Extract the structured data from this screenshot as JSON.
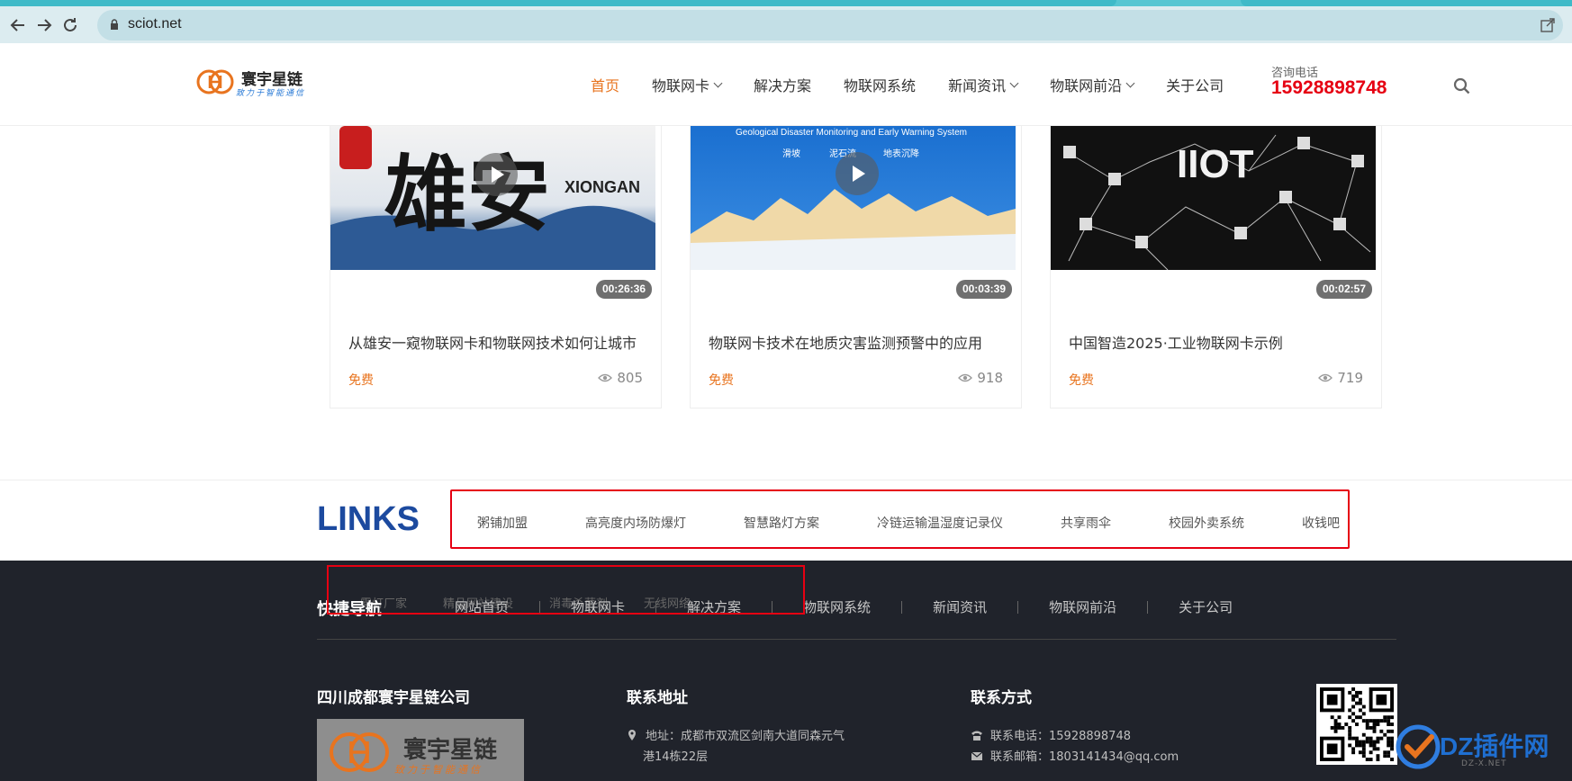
{
  "browser": {
    "url": "sciot.net",
    "back_icon": "arrow-left-icon",
    "forward_icon": "arrow-right-icon",
    "reload_icon": "reload-icon"
  },
  "header": {
    "logo_text": "寰宇星链",
    "logo_slogan": "致力于智能通信",
    "nav": [
      {
        "label": "首页",
        "active": true,
        "dropdown": false
      },
      {
        "label": "物联网卡",
        "active": false,
        "dropdown": true
      },
      {
        "label": "解决方案",
        "active": false,
        "dropdown": false
      },
      {
        "label": "物联网系统",
        "active": false,
        "dropdown": false
      },
      {
        "label": "新闻资讯",
        "active": false,
        "dropdown": true
      },
      {
        "label": "物联网前沿",
        "active": false,
        "dropdown": true
      },
      {
        "label": "关于公司",
        "active": false,
        "dropdown": false
      }
    ],
    "hotline_label": "咨询电话",
    "hotline_number": "15928898748"
  },
  "videos": [
    {
      "thumb_text": "XIONGAN",
      "duration": "00:26:36",
      "title": "从雄安一窥物联网卡和物联网技术如何让城市",
      "price": "免费",
      "views": "805"
    },
    {
      "thumb_text": "Geological Disaster Monitoring and Early Warning System",
      "thumb_tags": [
        "滑坡",
        "泥石流",
        "地表沉降"
      ],
      "duration": "00:03:39",
      "title": "物联网卡技术在地质灾害监测预警中的应用",
      "price": "免费",
      "views": "918"
    },
    {
      "thumb_text": "IIOT",
      "duration": "00:02:57",
      "title": "中国智造2025·工业物联网卡示例",
      "price": "免费",
      "views": "719"
    }
  ],
  "links": {
    "title": "LINKS",
    "items": [
      "粥铺加盟",
      "高亮度内场防爆灯",
      "智慧路灯方案",
      "冷链运输温湿度记录仪",
      "共享雨伞",
      "校园外卖系统",
      "收钱吧"
    ]
  },
  "footer": {
    "nav_title": "快捷导航",
    "nav": [
      "网站首页",
      "物联网卡",
      "解决方案",
      "物联网系统",
      "新闻资讯",
      "物联网前沿",
      "关于公司"
    ],
    "ghost_links": [
      "雾灯厂家",
      "精品网站建设",
      "消毒杀菌剂",
      "无线网络"
    ],
    "company_title": "四川成都寰宇星链公司",
    "company_logo_text": "寰宇星链",
    "company_logo_slogan": "致力于智能通信",
    "address_title": "联系地址",
    "address_line1": "地址：成都市双流区剑南大道同森元气",
    "address_line2": "港14栋22层",
    "contact_title": "联系方式",
    "phone": "联系电话：15928898748",
    "email": "联系邮箱：1803141434@qq.com"
  },
  "watermark": {
    "text": "DZ插件网",
    "sub": "DZ-X.NET"
  },
  "colors": {
    "accent": "#e8741f",
    "hotline": "#e60012",
    "links_title": "#1c4a9f",
    "footer_bg": "#20232b",
    "highlight_box": "#e60012"
  }
}
